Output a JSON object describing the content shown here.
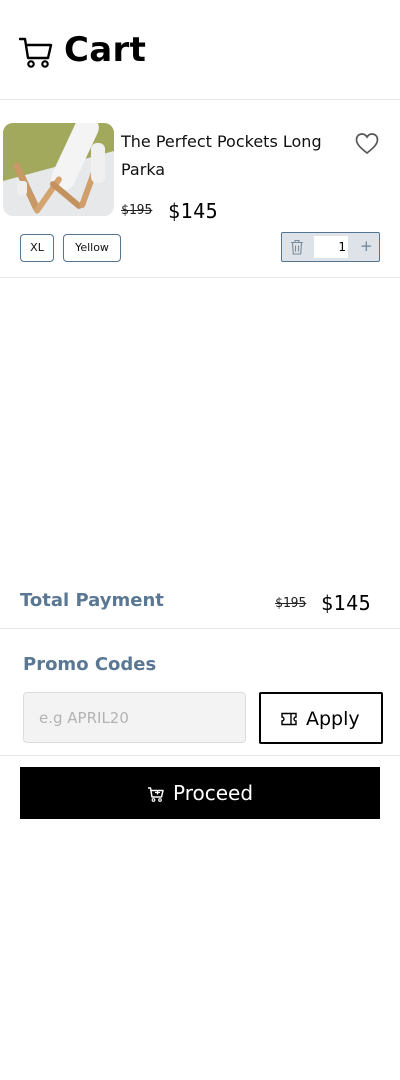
{
  "header": {
    "title": "Cart",
    "icon": "cart-icon"
  },
  "item": {
    "name": "The Perfect Pockets Long Parka",
    "old_price": "$195",
    "price": "$145",
    "size": "XL",
    "color": "Yellow",
    "quantity": "1",
    "favorite_icon": "heart-icon",
    "remove_icon": "trash-icon",
    "increase_icon": "plus-icon"
  },
  "summary": {
    "total_label": "Total Payment",
    "old_total": "$195",
    "total": "$145"
  },
  "promo": {
    "label": "Promo Codes",
    "placeholder": "e.g APRIL20",
    "value": "",
    "apply_label": "Apply",
    "apply_icon": "ticket-icon"
  },
  "proceed": {
    "label": "Proceed",
    "icon": "cart-icon"
  },
  "colors": {
    "accent": "#5a7893",
    "border": "#55748f",
    "qty_bg": "#dde3e8",
    "button": "#000000"
  }
}
